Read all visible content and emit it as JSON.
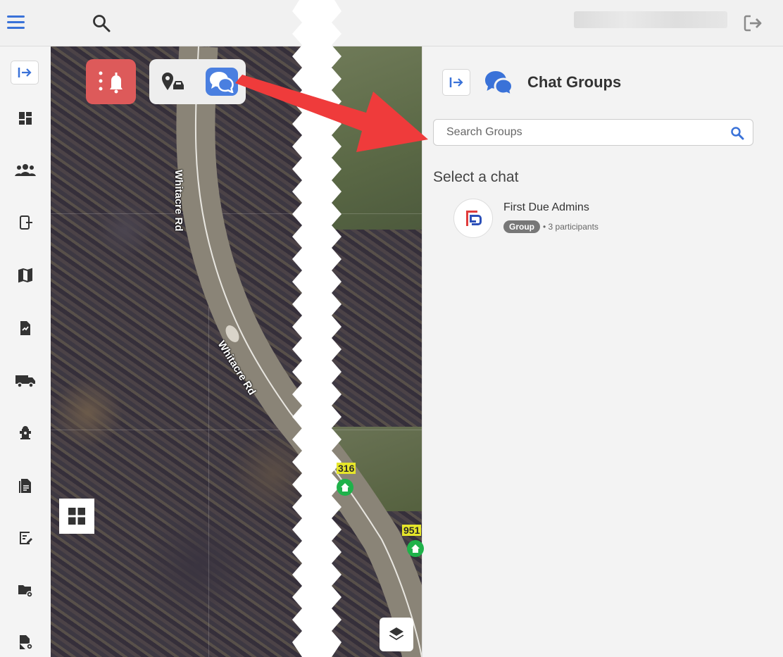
{
  "topbar": {
    "menu_icon": "hamburger-menu-icon",
    "search_icon": "search-icon",
    "logout_icon": "logout-icon"
  },
  "sidebar": {
    "items": [
      {
        "icon": "collapse-panel-icon"
      },
      {
        "icon": "dashboard-icon"
      },
      {
        "icon": "people-group-icon"
      },
      {
        "icon": "device-exit-icon"
      },
      {
        "icon": "map-icon"
      },
      {
        "icon": "checklist-document-icon"
      },
      {
        "icon": "fire-truck-icon"
      },
      {
        "icon": "fire-hydrant-icon"
      },
      {
        "icon": "report-document-icon"
      },
      {
        "icon": "preplan-edit-icon"
      },
      {
        "icon": "folder-settings-icon"
      },
      {
        "icon": "document-settings-icon"
      }
    ]
  },
  "map": {
    "road_labels": [
      "Whitacre Rd",
      "Whitacre Rd"
    ],
    "markers": [
      "316",
      "951"
    ],
    "buttons": {
      "alerts_icon": "bell-alert-icon",
      "location_icon": "location-vehicle-icon",
      "chat_icon": "chat-bubbles-icon",
      "grid_icon": "grid-view-icon",
      "layers_icon": "layers-icon"
    }
  },
  "panel": {
    "title": "Chat Groups",
    "search": {
      "placeholder": "Search Groups",
      "value": ""
    },
    "select_title": "Select a chat",
    "chats": [
      {
        "name": "First Due Admins",
        "badge": "Group",
        "participants": "• 3 participants"
      }
    ]
  },
  "colors": {
    "accent": "#4a7fe0",
    "alert": "#dd5a5a",
    "arrow": "#ef3b3b",
    "badge": "#777777"
  }
}
